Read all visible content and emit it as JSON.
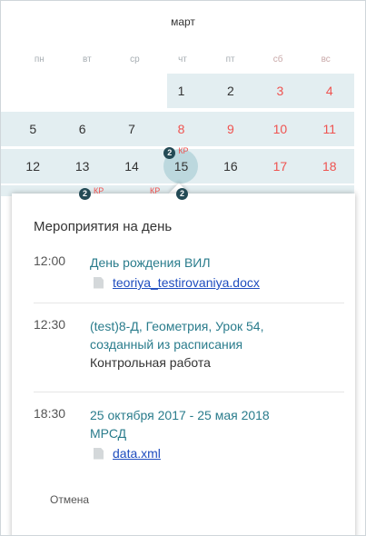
{
  "calendar": {
    "month": "март",
    "weekdays": [
      "пн",
      "вт",
      "ср",
      "чт",
      "пт",
      "сб",
      "вс"
    ],
    "weeks": [
      [
        "",
        "",
        "",
        "1",
        "2",
        "3",
        "4"
      ],
      [
        "5",
        "6",
        "7",
        "8",
        "9",
        "10",
        "11"
      ],
      [
        "12",
        "13",
        "14",
        "15",
        "16",
        "17",
        "18"
      ]
    ],
    "today": "15",
    "today_badge": "2",
    "today_badge_label": "КР",
    "next_week_badges": [
      {
        "badge": "2",
        "label": "КР"
      },
      {
        "label": "КР"
      },
      {
        "badge": "2"
      }
    ]
  },
  "popup": {
    "title": "Мероприятия на день",
    "events": [
      {
        "time": "12:00",
        "title": "День рождения ВИЛ",
        "attachment": "teoriya_testirovaniya.docx"
      },
      {
        "time": "12:30",
        "title_line1": "(test)8-Д, Геометрия, Урок 54,",
        "title_line2": "созданный из расписания",
        "subtitle": "Контрольная работа"
      },
      {
        "time": "18:30",
        "dates": "25 октября 2017 - 25 мая 2018",
        "title": "МРСД",
        "attachment": "data.xml"
      }
    ],
    "cancel_label": "Отмена"
  },
  "colors": {
    "week_row_bg": "#e3eef1",
    "weekend_red": "#ef5350",
    "event_title": "#2a7c8c",
    "link_blue": "#1f4dbf",
    "badge_dark": "#234a55"
  }
}
